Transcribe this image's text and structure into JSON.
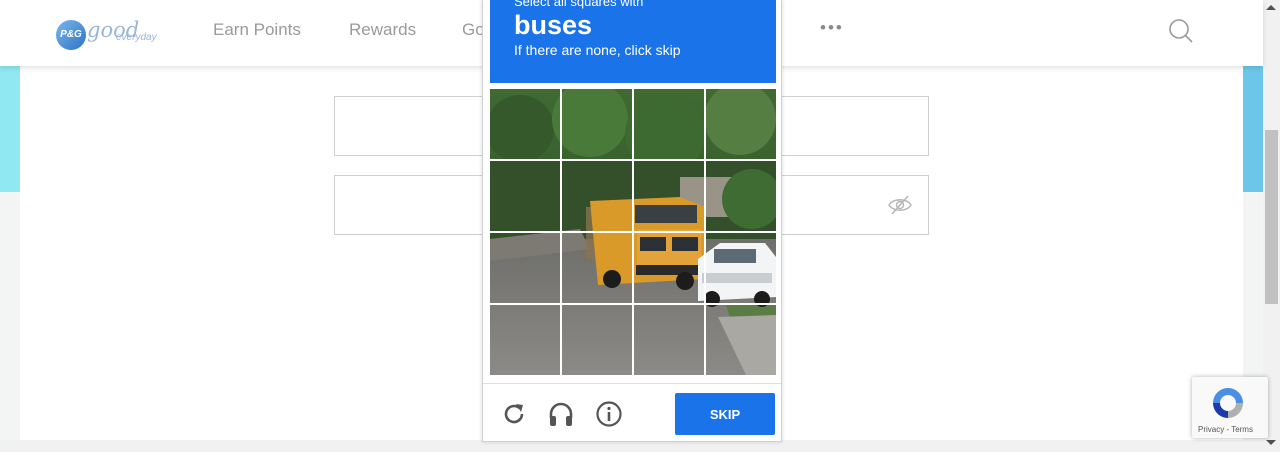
{
  "header": {
    "logo": {
      "badge": "P&G",
      "word": "good",
      "tagline": "everyday"
    },
    "nav": [
      {
        "label": "Earn Points"
      },
      {
        "label": "Rewards"
      },
      {
        "label": "Go"
      }
    ],
    "more_label": "•••",
    "search_icon": "search-icon"
  },
  "login_form": {
    "username_value": "",
    "password_value": "",
    "password_toggle_icon": "eye-slash-icon"
  },
  "challenge": {
    "instruction_prefix": "Select all squares with",
    "target": "buses",
    "instruction_sub": "If there are none, click skip",
    "grid": {
      "rows": 4,
      "cols": 4
    },
    "footer": {
      "reload_icon": "reload-icon",
      "audio_icon": "headphones-icon",
      "info_icon": "info-icon",
      "skip_label": "SKIP"
    },
    "accent_color": "#1a73e8"
  },
  "recaptcha_badge": {
    "links": "Privacy - Terms"
  }
}
